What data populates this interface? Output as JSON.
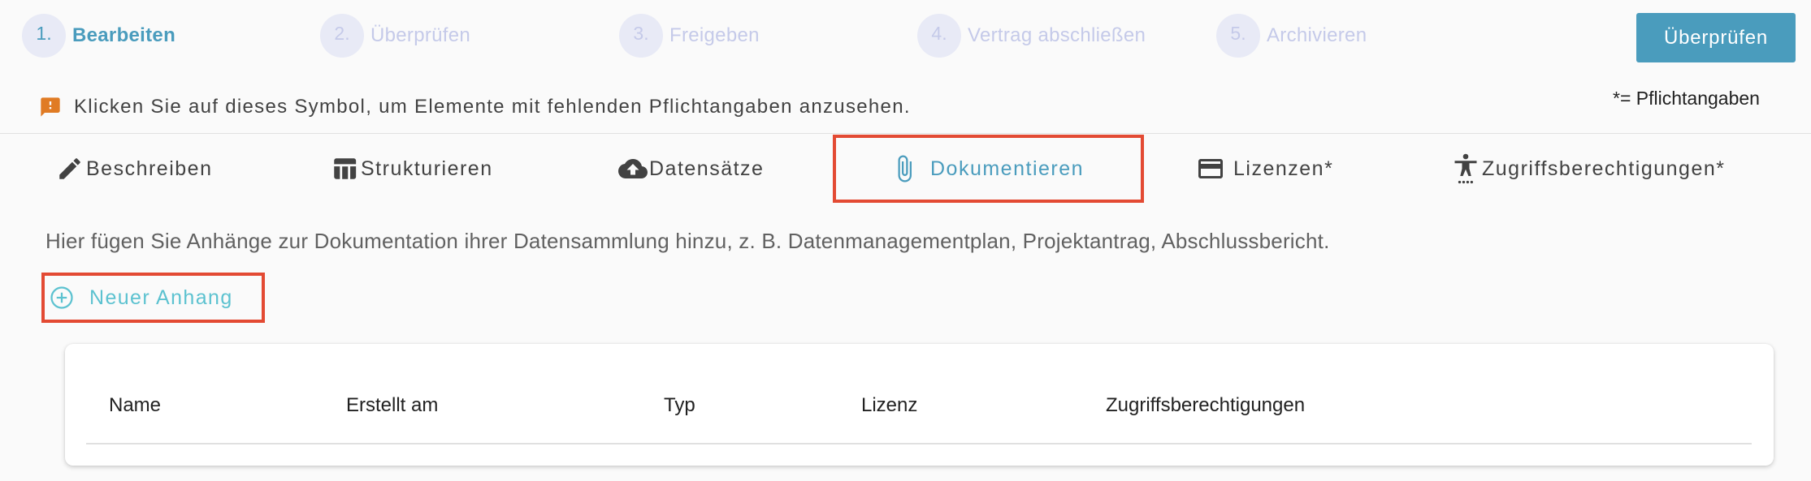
{
  "stepper": {
    "steps": [
      {
        "num": "1.",
        "label": "Bearbeiten"
      },
      {
        "num": "2.",
        "label": "Überprüfen"
      },
      {
        "num": "3.",
        "label": "Freigeben"
      },
      {
        "num": "4.",
        "label": "Vertrag abschließen"
      },
      {
        "num": "5.",
        "label": "Archivieren"
      }
    ],
    "active_step": 1
  },
  "review_button": "Überprüfen",
  "notice": {
    "icon": "warning-message-icon",
    "text": "Klicken Sie auf dieses Symbol, um Elemente mit fehlenden Pflichtangaben anzusehen."
  },
  "required_hint": "*= Pflichtangaben",
  "tabs": [
    {
      "label": "Beschreiben",
      "icon": "pencil-icon"
    },
    {
      "label": "Strukturieren",
      "icon": "table-icon"
    },
    {
      "label": "Datensätze",
      "icon": "cloud-upload-icon"
    },
    {
      "label": "Dokumentieren",
      "icon": "paperclip-icon"
    },
    {
      "label": "Lizenzen*",
      "icon": "credit-card-icon"
    },
    {
      "label": "Zugriffsberechtigungen*",
      "icon": "accessibility-icon"
    }
  ],
  "active_tab": "Dokumentieren",
  "description": "Hier fügen Sie Anhänge zur Dokumentation ihrer Datensammlung hinzu, z. B. Datenmanagementplan, Projektantrag, Abschlussbericht.",
  "new_attachment_button": "Neuer Anhang",
  "table": {
    "columns": [
      "Name",
      "Erstellt am",
      "Typ",
      "Lizenz",
      "Zugriffsberechtigungen"
    ],
    "rows": []
  },
  "colors": {
    "accent": "#4a9cbd",
    "accent_light": "#5cc2d0",
    "warning": "#e07b24",
    "highlight": "#e34a33",
    "inactive": "#c5cae9"
  }
}
